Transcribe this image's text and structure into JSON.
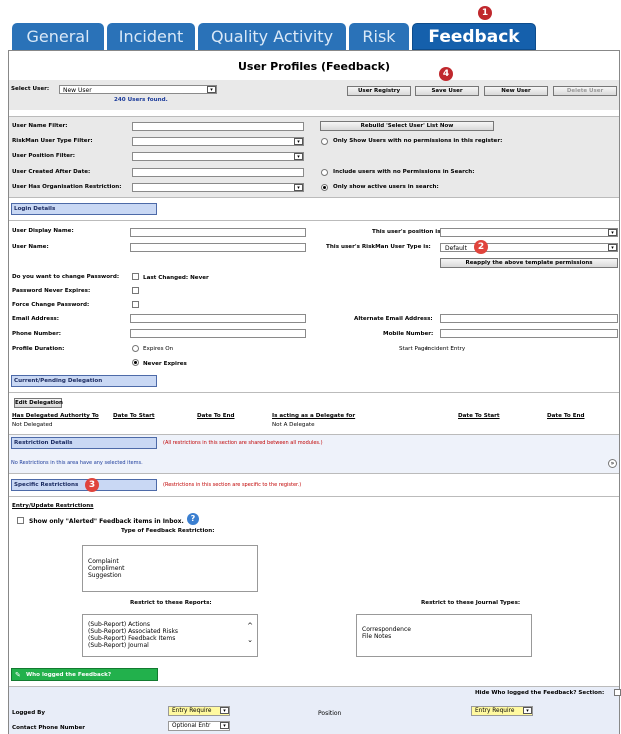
{
  "tabs": [
    {
      "label": "General"
    },
    {
      "label": "Incident"
    },
    {
      "label": "Quality Activity"
    },
    {
      "label": "Risk"
    },
    {
      "label": "Feedback"
    }
  ],
  "badges": {
    "b1": "1",
    "b2": "2",
    "b3": "3",
    "b4": "4"
  },
  "page_title": "User Profiles (Feedback)",
  "select_user": {
    "label": "Select User:",
    "value": "New User",
    "count": "240 Users found."
  },
  "toolbar": {
    "registry": "User Registry",
    "save": "Save User",
    "new": "New User",
    "delete": "Delete User"
  },
  "filters": {
    "name": "User Name Filter:",
    "type": "RiskMan User Type Filter:",
    "position": "User Position Filter:",
    "created": "User Created After Date:",
    "org": "User Has Organisation Restriction:",
    "rebuild": "Rebuild 'Select User' List Now",
    "opt1": "Only Show Users with no permissions in this register:",
    "opt2": "Include users with no Permissions in Search:",
    "opt3": "Only show active users in search:"
  },
  "login": {
    "header": "Login Details",
    "display_name": "User Display Name:",
    "user_name": "User Name:",
    "position": "This user's position is:",
    "type": "This user's RiskMan User Type is:",
    "type_value": "Default",
    "reapply": "Reapply the above template permissions",
    "change_pw": "Do you want to change Password:",
    "last_changed": "Last Changed: Never",
    "never_expires": "Password Never Expires:",
    "force_change": "Force Change Password:",
    "email": "Email Address:",
    "alt_email": "Alternate Email Address:",
    "phone": "Phone Number:",
    "mobile": "Mobile Number:",
    "duration": "Profile Duration:",
    "expires_on": "Expires On",
    "never_expire": "Never Expires",
    "start_page_label": "Start Page:",
    "start_page": "Incident Entry"
  },
  "delegation": {
    "header": "Current/Pending Delegation",
    "edit": "Edit Delegation",
    "cols": [
      "Has Delegated Authority To",
      "Date To Start",
      "Date To End",
      "Is acting as a Delegate for",
      "Date To Start",
      "Date To End"
    ],
    "val1": "Not Delegated",
    "val2": "Not A Delegate"
  },
  "restriction": {
    "header": "Restriction Details",
    "note": "(All restrictions in this section are shared between all modules.)",
    "empty": "No Restrictions in this area have any selected items.",
    "toggle": "»"
  },
  "specific": {
    "header": "Specific Restrictions",
    "note": "(Restrictions in this section are specific to the register.)"
  },
  "entry": {
    "header": "Entry/Update Restrictions",
    "alerted": "Show only \"Alerted\" Feedback items in Inbox.",
    "type_title": "Type of Feedback Restriction:",
    "types": [
      "Complaint",
      "Compliment",
      "Suggestion"
    ],
    "reports_title": "Restrict to these Reports:",
    "reports": [
      "(Sub-Report) Actions",
      "(Sub-Report) Associated Risks",
      "(Sub-Report) Feedback Items",
      "(Sub-Report) Journal"
    ],
    "journal_title": "Restrict to these Journal Types:",
    "journals": [
      "Correspondence",
      "File Notes"
    ]
  },
  "logged": {
    "header": "Who logged the Feedback?",
    "hide": "Hide Who logged the Feedback? Section:",
    "logged_by": "Logged By",
    "logged_by_value": "Entry Require",
    "position": "Position",
    "position_value": "Entry Require",
    "contact": "Contact Phone Number",
    "contact_value": "Optional Entr"
  },
  "colors": {
    "tab": "#2a72b8",
    "tab_active": "#1560ac",
    "section": "#c9d8f4",
    "badge": "#c0282d",
    "green": "#22b14c",
    "yellow": "#fff9a0"
  }
}
